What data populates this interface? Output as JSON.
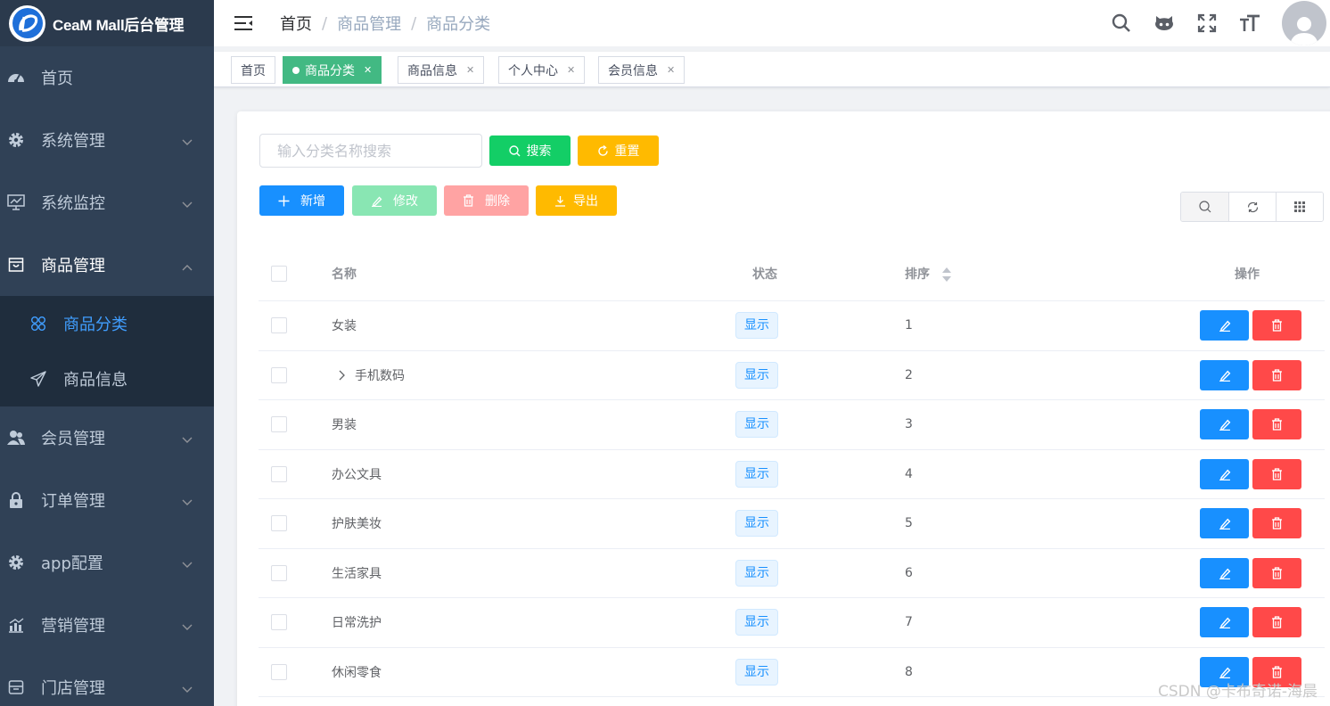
{
  "app": {
    "title": "CeaM Mall后台管理"
  },
  "sidebar": {
    "items": [
      {
        "label": "首页",
        "icon": "dashboard-icon"
      },
      {
        "label": "系统管理",
        "icon": "gear-icon"
      },
      {
        "label": "系统监控",
        "icon": "monitor-icon"
      },
      {
        "label": "商品管理",
        "icon": "shopping-bag-icon"
      },
      {
        "label": "会员管理",
        "icon": "people-icon"
      },
      {
        "label": "订单管理",
        "icon": "lock-icon"
      },
      {
        "label": "app配置",
        "icon": "gear-icon"
      },
      {
        "label": "营销管理",
        "icon": "chart-icon"
      },
      {
        "label": "门店管理",
        "icon": "store-icon"
      }
    ],
    "submenu": [
      {
        "label": "商品分类",
        "icon": "category-icon"
      },
      {
        "label": "商品信息",
        "icon": "send-icon"
      }
    ]
  },
  "breadcrumb": [
    "首页",
    "商品管理",
    "商品分类"
  ],
  "tags": [
    {
      "label": "首页"
    },
    {
      "label": "商品分类"
    },
    {
      "label": "商品信息"
    },
    {
      "label": "个人中心"
    },
    {
      "label": "会员信息"
    }
  ],
  "search": {
    "placeholder": "输入分类名称搜索",
    "search_label": "搜索",
    "reset_label": "重置"
  },
  "toolbar": {
    "add_label": "新增",
    "edit_label": "修改",
    "delete_label": "删除",
    "export_label": "导出"
  },
  "table": {
    "columns": [
      "名称",
      "状态",
      "排序",
      "操作"
    ],
    "rows": [
      {
        "name": "女装",
        "status": "显示",
        "sort": "1",
        "expandable": false
      },
      {
        "name": "手机数码",
        "status": "显示",
        "sort": "2",
        "expandable": true
      },
      {
        "name": "男装",
        "status": "显示",
        "sort": "3",
        "expandable": false
      },
      {
        "name": "办公文具",
        "status": "显示",
        "sort": "4",
        "expandable": false
      },
      {
        "name": "护肤美妆",
        "status": "显示",
        "sort": "5",
        "expandable": false
      },
      {
        "name": "生活家具",
        "status": "显示",
        "sort": "6",
        "expandable": false
      },
      {
        "name": "日常洗护",
        "status": "显示",
        "sort": "7",
        "expandable": false
      },
      {
        "name": "休闲零食",
        "status": "显示",
        "sort": "8",
        "expandable": false
      }
    ]
  },
  "watermark": "CSDN @卡布奇诺-海晨",
  "colors": {
    "sidebar_bg": "#304156",
    "active_menu": "#409eff",
    "tag_active": "#42b983",
    "primary": "#1890ff",
    "success": "#13ce66",
    "warning": "#ffba00",
    "danger": "#ff4949"
  }
}
